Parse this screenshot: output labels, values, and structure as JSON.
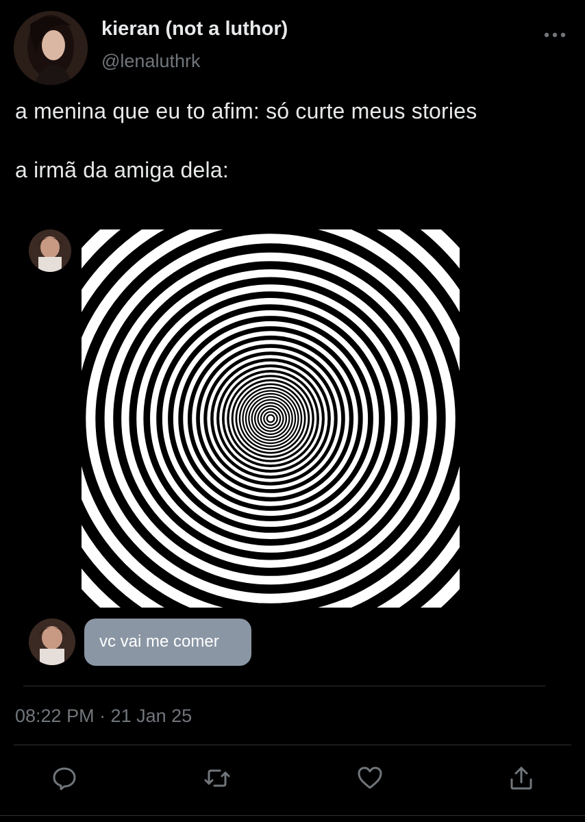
{
  "tweet": {
    "author": {
      "display_name": "kieran (not a luthor)",
      "handle": "@lenaluthrk",
      "avatar_icon": "profile-photo-avatar"
    },
    "text_lines": [
      "a menina que eu to afim: só curte meus stories",
      "a irmã da amiga dela:"
    ],
    "media": {
      "chat": {
        "image_icon": "hypnotic-spiral-image",
        "message": "vc vai me comer",
        "bubble_color": "#8a96a3"
      }
    },
    "timestamp": "08:22 PM · 21 Jan 25",
    "actions": [
      {
        "icon": "reply-icon"
      },
      {
        "icon": "retweet-icon"
      },
      {
        "icon": "like-icon"
      },
      {
        "icon": "share-icon"
      }
    ]
  },
  "colors": {
    "background": "#000000",
    "primary_text": "#e7e9ea",
    "secondary_text": "#71767b",
    "divider": "#2f3336"
  }
}
